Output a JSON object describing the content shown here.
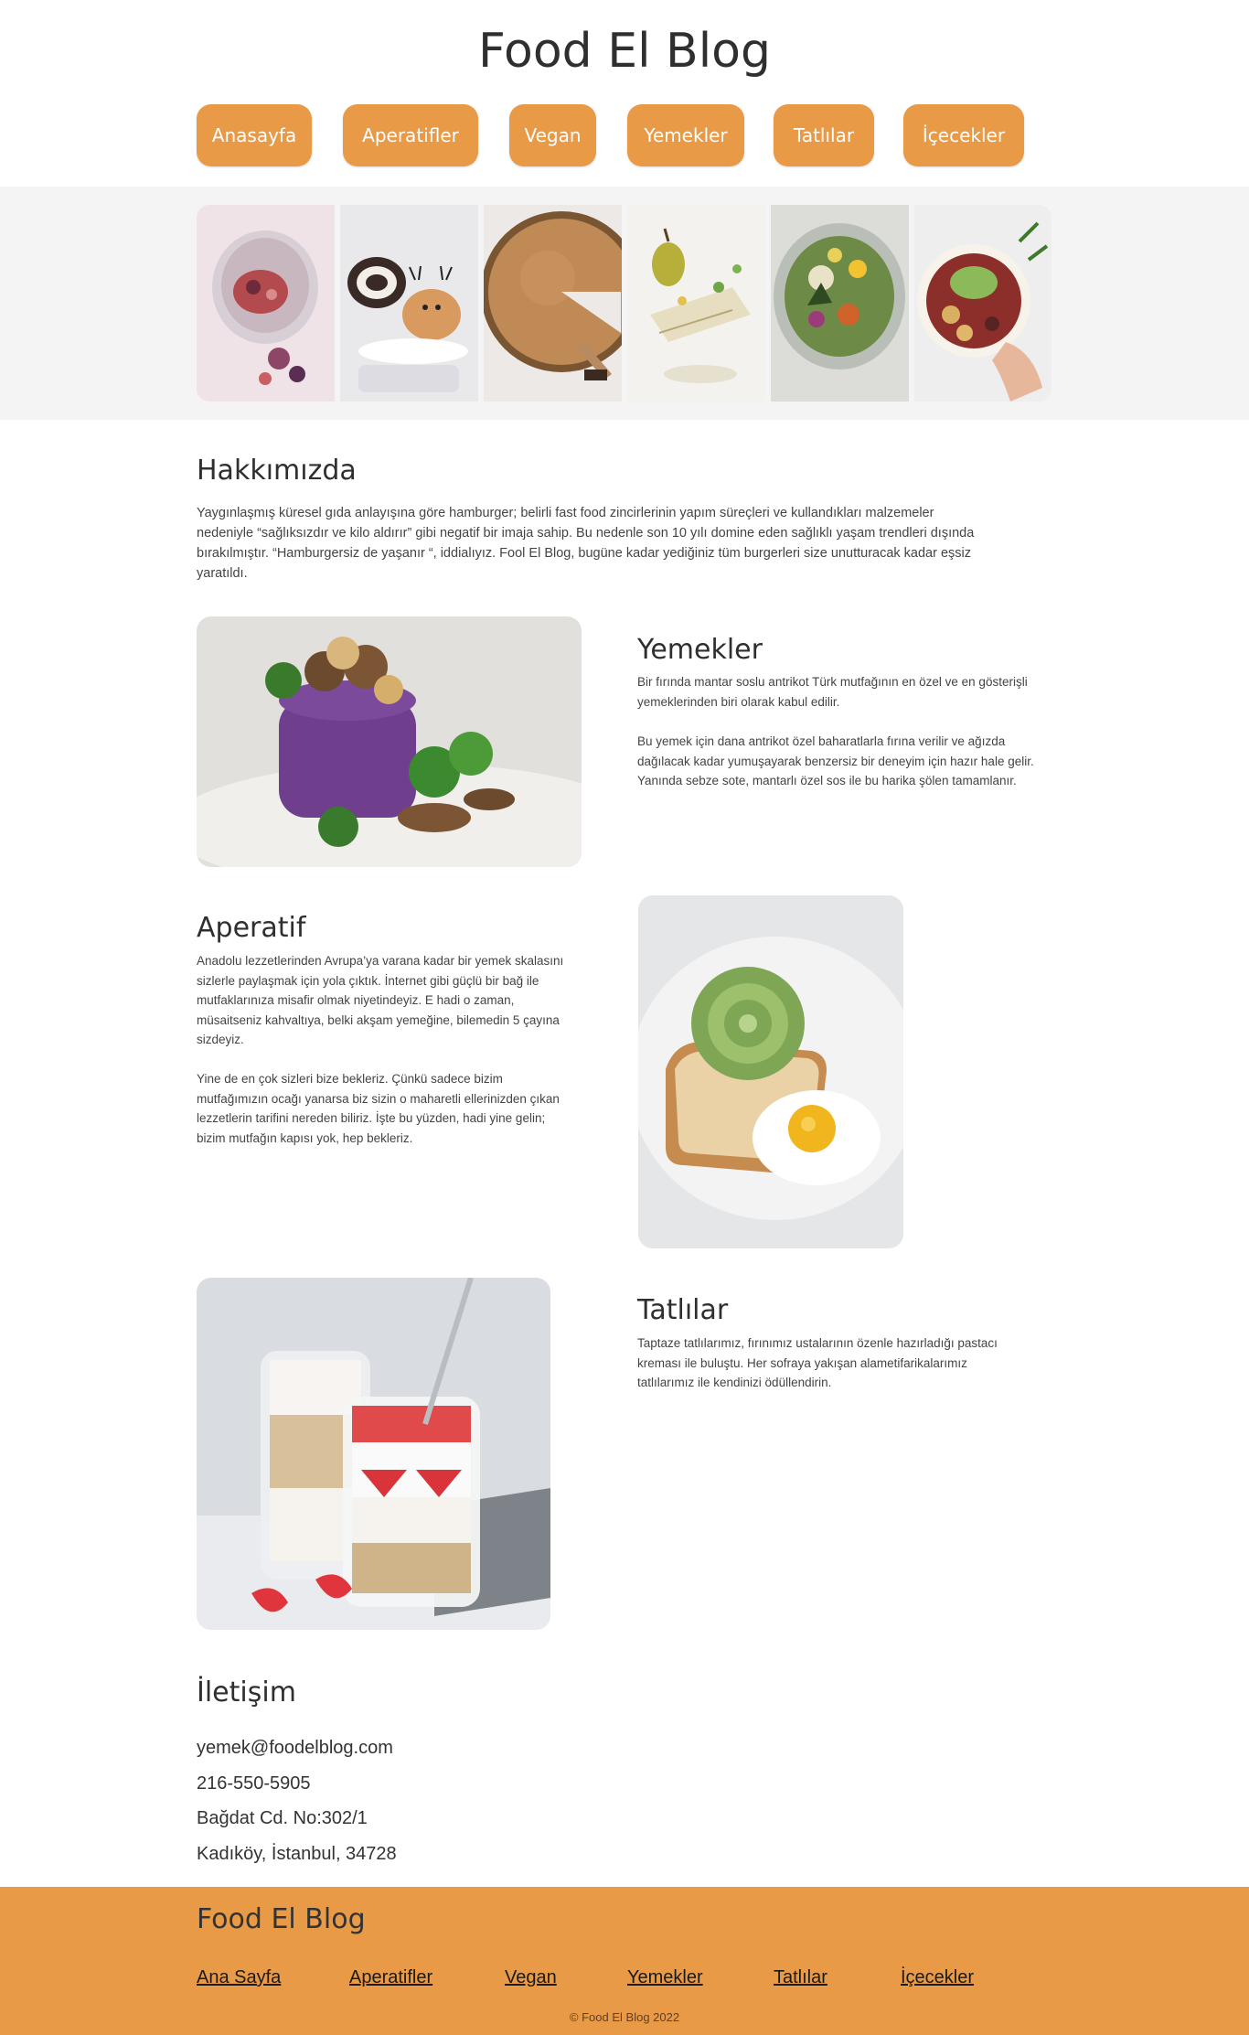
{
  "header": {
    "title": "Food El Blog"
  },
  "nav": {
    "items": [
      {
        "label": "Anasayfa"
      },
      {
        "label": "Aperatifler"
      },
      {
        "label": "Vegan"
      },
      {
        "label": "Yemekler"
      },
      {
        "label": "Tatlılar"
      },
      {
        "label": "İçecekler"
      }
    ]
  },
  "gallery": {
    "images": [
      "chia-pudding-jar",
      "chocolate-roll-cake",
      "pie-slice",
      "pear-dessert",
      "salad-glass",
      "bowl-hand"
    ]
  },
  "about": {
    "title": "Hakkımızda",
    "text": "Yaygınlaşmış küresel gıda anlayışına göre hamburger; belirli fast food zincirlerinin yapım süreçleri ve kullandıkları malzemeler nedeniyle “sağlıksızdır ve kilo aldırır” gibi negatif bir imaja sahip. Bu nedenle son 10 yılı domine eden sağlıklı yaşam trendleri dışında bırakılmıştır. “Hamburgersiz de yaşanır “, iddialıyız. Fool El Blog, bugüne kadar yediğiniz tüm burgerleri size unutturacak kadar eşsiz yaratıldı."
  },
  "yemekler": {
    "title": "Yemekler",
    "p1": "Bir fırında mantar soslu antrikot Türk mutfağının en özel ve en gösterişli yemeklerinden biri olarak kabul edilir.",
    "p2": "Bu yemek için dana antrikot özel baharatlarla fırına verilir ve ağızda dağılacak kadar yumuşayarak benzersiz bir deneyim için hazır hale gelir. Yanında sebze sote, mantarlı özel sos ile bu harika şölen tamamlanır."
  },
  "aperatif": {
    "title": "Aperatif",
    "p1": "Anadolu lezzetlerinden Avrupa’ya varana kadar bir yemek skalasını sizlerle paylaşmak için yola çıktık. İnternet gibi güçlü bir bağ ile mutfaklarınıza misafir olmak niyetindeyiz. E hadi o zaman, müsaitseniz kahvaltıya, belki akşam yemeğine, bilemedin 5 çayına sizdeyiz.",
    "p2": "Yine de en çok sizleri bize bekleriz. Çünkü sadece bizim mutfağımızın ocağı yanarsa biz sizin o maharetli ellerinizden çıkan lezzetlerin tarifini nereden biliriz. İşte bu yüzden, hadi yine gelin; bizim mutfağın kapısı yok, hep bekleriz."
  },
  "tatlilar": {
    "title": "Tatlılar",
    "text": "Taptaze tatlılarımız, fırınımız ustalarının özenle hazırladığı pastacı kreması ile buluştu. Her sofraya yakışan alametifarikalarımız tatlılarımız ile kendinizi ödüllendirin."
  },
  "contact": {
    "title": "İletişim",
    "email": "yemek@foodelblog.com",
    "phone": "216-550-5905",
    "address1": "Bağdat Cd. No:302/1",
    "address2": "Kadıköy, İstanbul, 34728"
  },
  "footer": {
    "title": "Food El Blog",
    "links": [
      {
        "label": "Ana Sayfa"
      },
      {
        "label": "Aperatifler"
      },
      {
        "label": "Vegan"
      },
      {
        "label": "Yemekler"
      },
      {
        "label": "Tatlılar"
      },
      {
        "label": "İçecekler"
      }
    ],
    "copyright": "© Food El Blog 2022"
  },
  "colors": {
    "accent": "#e89a46",
    "band": "#f4f4f4",
    "text": "#333333"
  }
}
